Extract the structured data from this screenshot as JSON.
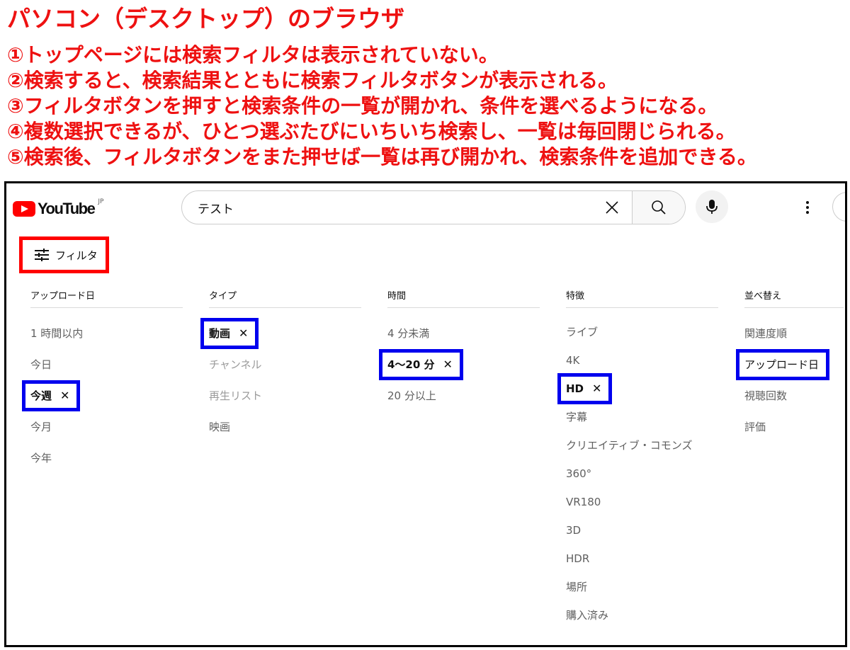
{
  "annotation": {
    "heading": "パソコン（デスクトップ）のブラウザ",
    "notes": [
      "①トップページには検索フィルタは表示されていない。",
      "②検索すると、検索結果とともに検索フィルタボタンが表示される。",
      "③フィルタボタンを押すと検索条件の一覧が開かれ、条件を選べるようになる。",
      "④複数選択できるが、ひとつ選ぶたびにいちいち検索し、一覧は毎回閉じられる。",
      "⑤検索後、フィルタボタンをまた押せば一覧は再び開かれ、検索条件を追加できる。"
    ],
    "colors": {
      "note_text": "#ee1111",
      "filter_highlight": "#ff0000",
      "selection_highlight": "#0000ee"
    }
  },
  "header": {
    "logo_text": "YouTube",
    "region": "JP",
    "search_value": "テスト",
    "icons": [
      "youtube-logo-icon",
      "clear-icon",
      "search-icon",
      "mic-icon",
      "more-vert-icon"
    ]
  },
  "filter_button": {
    "label": "フィルタ",
    "icon": "tune-icon"
  },
  "filters": {
    "upload_date": {
      "title": "アップロード日",
      "options": [
        "1 時間以内",
        "今日",
        "今週",
        "今月",
        "今年"
      ],
      "selected": "今週"
    },
    "type": {
      "title": "タイプ",
      "options": [
        "動画",
        "チャンネル",
        "再生リスト",
        "映画"
      ],
      "selected": "動画"
    },
    "duration": {
      "title": "時間",
      "options": [
        "4 分未満",
        "4〜20 分",
        "20 分以上"
      ],
      "selected": "4〜20 分"
    },
    "features": {
      "title": "特徴",
      "options": [
        "ライブ",
        "4K",
        "HD",
        "字幕",
        "クリエイティブ・コモンズ",
        "360°",
        "VR180",
        "3D",
        "HDR",
        "場所",
        "購入済み"
      ],
      "selected": "HD"
    },
    "sort": {
      "title": "並べ替え",
      "options": [
        "関連度順",
        "アップロード日",
        "視聴回数",
        "評価"
      ],
      "selected": "アップロード日"
    }
  }
}
